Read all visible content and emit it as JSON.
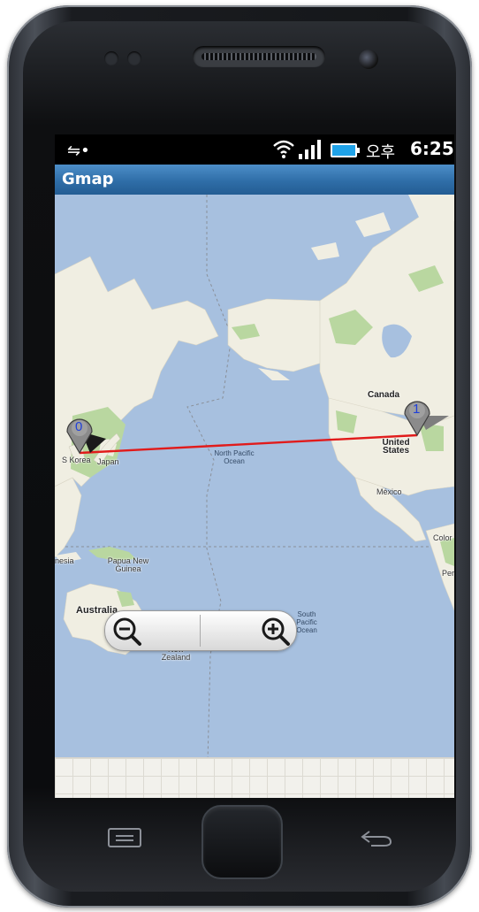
{
  "status_bar": {
    "ampm": "오후",
    "time": "6:25",
    "icons": [
      "usb-icon",
      "wifi-icon",
      "signal-icon",
      "battery-icon"
    ]
  },
  "app": {
    "title": "Gmap"
  },
  "map": {
    "labels": {
      "canada": "Canada",
      "united_states": "United States",
      "mexico": "México",
      "s_korea": "S Korea",
      "japan": "Japan",
      "north_pacific": "North Pacific Ocean",
      "south_pacific": "South Pacific Ocean",
      "australia": "Australia",
      "new_zealand": "New Zealand",
      "papua": "Papua New Guinea",
      "indonesia_partial": "nesia",
      "colombia_partial": "Color",
      "peru_partial": "Per"
    },
    "markers": [
      {
        "label": "0",
        "place": "S Korea"
      },
      {
        "label": "1",
        "place": "United States"
      }
    ],
    "route_color": "#e11b1b"
  },
  "zoom": {
    "out_icon": "zoom-out-icon",
    "in_icon": "zoom-in-icon"
  },
  "hardware": {
    "menu_icon": "menu-icon",
    "back_icon": "back-icon"
  }
}
